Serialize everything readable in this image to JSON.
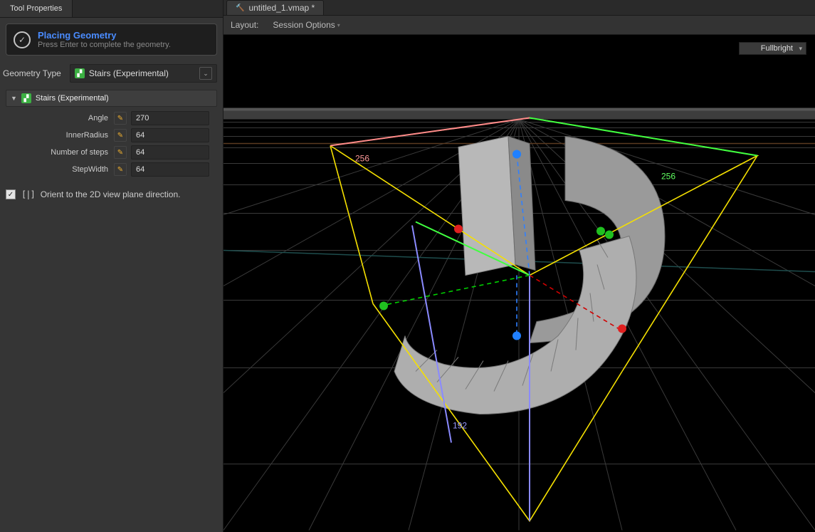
{
  "sidebar": {
    "tab_label": "Tool Properties",
    "banner": {
      "title": "Placing Geometry",
      "subtitle": "Press Enter to complete the geometry."
    },
    "geometry_type": {
      "label": "Geometry Type",
      "value": "Stairs (Experimental)"
    },
    "section_title": "Stairs (Experimental)",
    "props": {
      "angle": {
        "label": "Angle",
        "value": "270"
      },
      "inner_radius": {
        "label": "InnerRadius",
        "value": "64"
      },
      "num_steps": {
        "label": "Number of steps",
        "value": "64"
      },
      "step_width": {
        "label": "StepWidth",
        "value": "64"
      }
    },
    "orient": {
      "checked": true,
      "label": "Orient to the 2D view plane direction."
    }
  },
  "viewport": {
    "doc_title": "untitled_1.vmap *",
    "toolbar": {
      "layout_label": "Layout:",
      "session_label": "Session Options"
    },
    "shade_mode": "Fullbright",
    "bbox_dims": {
      "x": "256",
      "y": "256",
      "z": "192"
    }
  }
}
